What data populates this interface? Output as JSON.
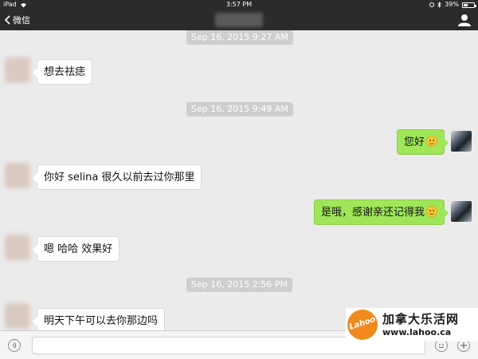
{
  "status_bar": {
    "device": "iPad",
    "time": "3:57 PM",
    "battery": "39%",
    "battery_level": 0.39
  },
  "nav": {
    "back_label": "微信"
  },
  "messages": [
    {
      "type": "timestamp",
      "text": "Sep 16, 2015 9:27 AM"
    },
    {
      "type": "received",
      "text": "想去祛痣"
    },
    {
      "type": "timestamp",
      "text": "Sep 16, 2015 9:49 AM"
    },
    {
      "type": "sent",
      "text": "您好",
      "emoji": "smile"
    },
    {
      "type": "received",
      "text": "你好 selina 很久以前去过你那里"
    },
    {
      "type": "sent",
      "text": "是哦，感谢亲还记得我",
      "emoji": "smile"
    },
    {
      "type": "received",
      "text": "嗯 哈哈 效果好"
    },
    {
      "type": "timestamp",
      "text": "Sep 16, 2015 2:56 PM"
    },
    {
      "type": "received",
      "text": "明天下午可以去你那边吗"
    }
  ],
  "input": {
    "placeholder": ""
  },
  "watermark": {
    "logo_text": "Lahoo",
    "title": "加拿大乐活网",
    "url": "www.lahoo.ca"
  },
  "colors": {
    "sent_bubble": "#9fe658",
    "received_bubble": "#ffffff",
    "bar": "#2b2b2b",
    "logo": "#f08a1e"
  }
}
